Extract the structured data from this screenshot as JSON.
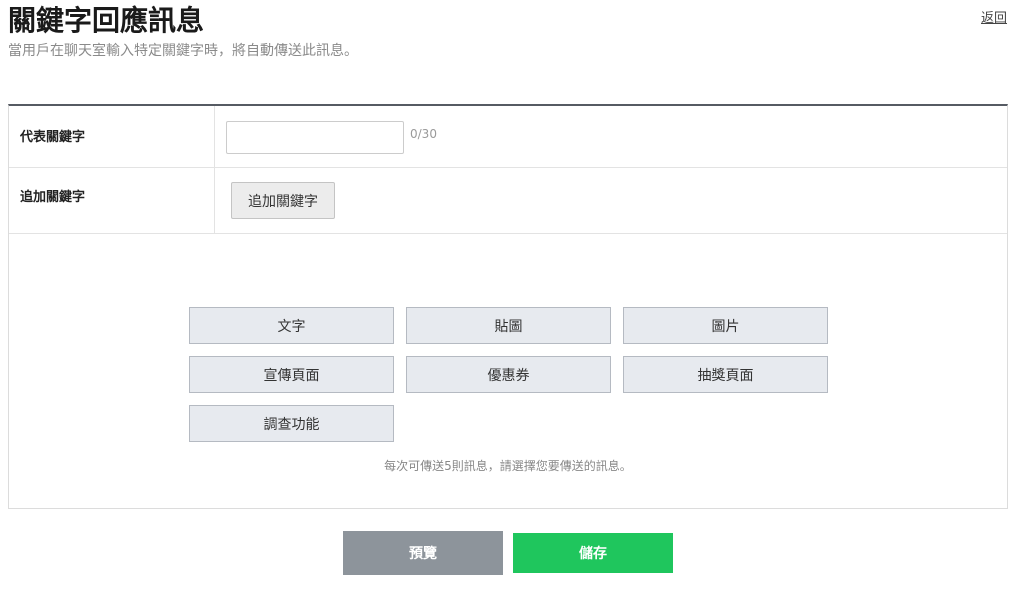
{
  "header": {
    "title": "關鍵字回應訊息",
    "subtitle": "當用戶在聊天室輸入特定關鍵字時，將自動傳送此訊息。",
    "back_label": "返回"
  },
  "form": {
    "main_keyword": {
      "label": "代表關鍵字",
      "value": "",
      "counter": "0/30"
    },
    "extra_keyword": {
      "label": "追加關鍵字",
      "button_label": "追加關鍵字"
    },
    "message_types": [
      "文字",
      "貼圖",
      "圖片",
      "宣傳頁面",
      "優惠券",
      "抽獎頁面",
      "調查功能"
    ],
    "message_note": "每次可傳送5則訊息，請選擇您要傳送的訊息。"
  },
  "actions": {
    "preview_label": "預覽",
    "save_label": "儲存"
  },
  "colors": {
    "preview_button": "#8d949b",
    "save_button": "#1fc65d"
  }
}
